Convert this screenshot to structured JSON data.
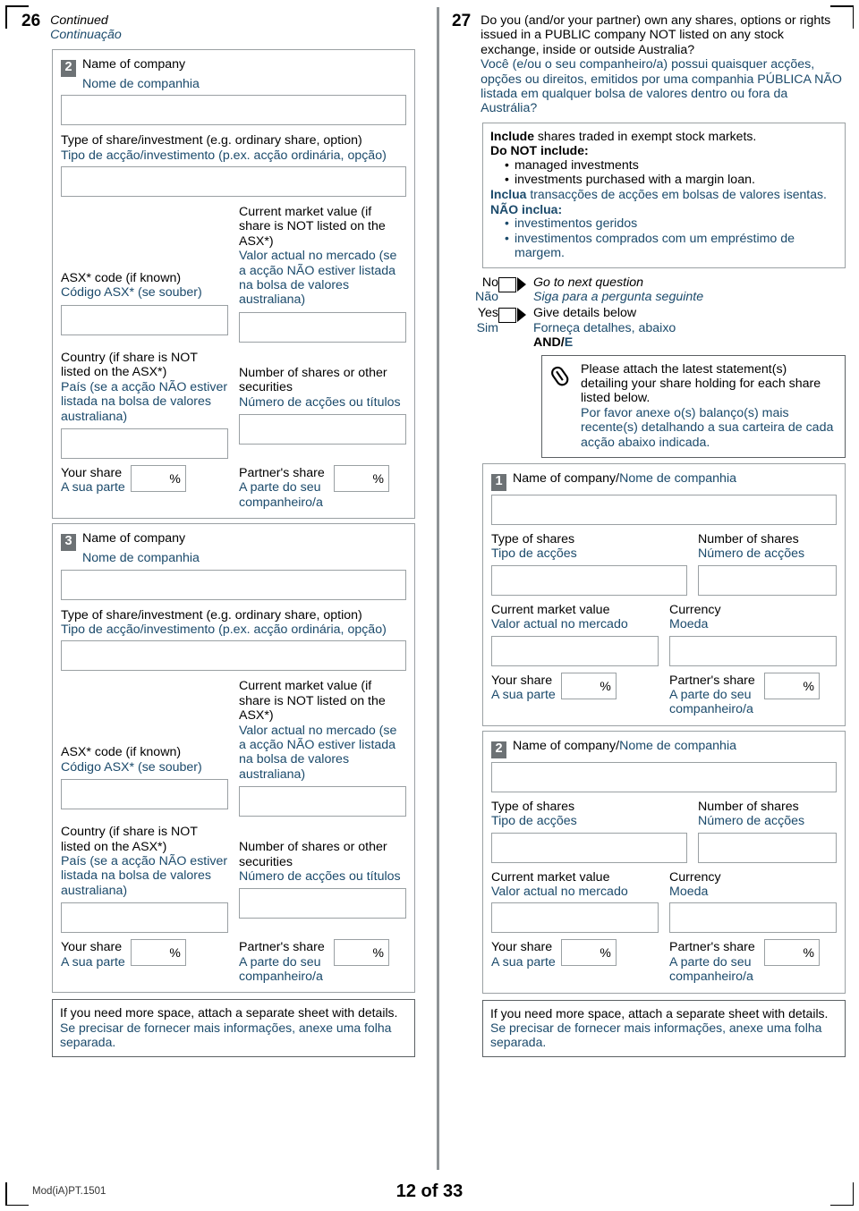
{
  "page": {
    "footer_code": "Mod(iA)PT.1501",
    "page_number": "12 of 33",
    "colors": {
      "accent_pt": "#1b4a6b",
      "badge_bg": "#6d7275",
      "box_border": "#9aa0a3"
    }
  },
  "question26": {
    "number": "26",
    "title_en": "Continued",
    "title_pt": "Continuação",
    "entries": [
      {
        "badge": "2",
        "name_of_company_en": "Name of company",
        "name_of_company_pt": "Nome de companhia",
        "type_of_share_en": "Type of share/investment (e.g. ordinary share, option)",
        "type_of_share_pt": "Tipo de acção/investimento (p.ex. acção ordinária, opção)",
        "asx_code_en": "ASX* code (if known)",
        "asx_code_pt": "Código ASX* (se souber)",
        "market_value_en": "Current market value (if share is NOT listed on the ASX*)",
        "market_value_pt": "Valor actual no mercado (se a acção NÃO estiver listada na bolsa de valores australiana)",
        "country_en": "Country (if share is NOT listed on the ASX*)",
        "country_pt": "País (se a acção NÃO estiver listada na bolsa de valores australiana)",
        "number_shares_en": "Number of shares or other securities",
        "number_shares_pt": "Número de acções ou títulos",
        "your_share_en": "Your share",
        "your_share_pt": "A sua parte",
        "partner_share_en": "Partner's share",
        "partner_share_pt": "A parte do seu companheiro/a",
        "percent_symbol": "%"
      },
      {
        "badge": "3",
        "name_of_company_en": "Name of company",
        "name_of_company_pt": "Nome de companhia",
        "type_of_share_en": "Type of share/investment (e.g. ordinary share, option)",
        "type_of_share_pt": "Tipo de acção/investimento (p.ex. acção ordinária, opção)",
        "asx_code_en": "ASX* code (if known)",
        "asx_code_pt": "Código ASX* (se souber)",
        "market_value_en": "Current market value (if share is NOT listed on the ASX*)",
        "market_value_pt": "Valor actual no mercado (se a acção NÃO estiver listada na bolsa de valores australiana)",
        "country_en": "Country (if share is NOT listed on the ASX*)",
        "country_pt": "País (se a acção NÃO estiver listada na bolsa de valores australiana)",
        "number_shares_en": "Number of shares or other securities",
        "number_shares_pt": "Número de acções ou títulos",
        "your_share_en": "Your share",
        "your_share_pt": "A sua parte",
        "partner_share_en": "Partner's share",
        "partner_share_pt": "A parte do seu companheiro/a",
        "percent_symbol": "%"
      }
    ],
    "more_space_en": "If you need more space, attach a separate sheet with details.",
    "more_space_pt": "Se precisar de fornecer mais informações, anexe uma folha separada."
  },
  "question27": {
    "number": "27",
    "question_en": "Do you (and/or your partner) own any shares, options or rights issued in a PUBLIC company NOT listed on any stock exchange, inside or outside Australia?",
    "question_pt": "Você (e/ou o seu companheiro/a) possui quaisquer acções, opções ou direitos, emitidos por uma companhia PÚBLICA NÃO listada em qualquer bolsa de valores dentro ou fora da Austrália?",
    "note": {
      "include_label_en": "Include",
      "include_text_en": " shares traded in exempt stock markets.",
      "donot_label_en": "Do NOT include:",
      "donot_items_en": [
        "managed investments",
        "investments purchased with a margin loan."
      ],
      "include_label_pt": "Inclua",
      "include_text_pt": " transacções de acções em bolsas de valores isentas.",
      "donot_label_pt": "NÃO inclua:",
      "donot_items_pt": [
        "investimentos geridos",
        "investimentos comprados com um empréstimo de margem."
      ]
    },
    "answers": {
      "no_en": "No",
      "no_pt": "Não",
      "no_action_en": "Go to next question",
      "no_action_pt": "Siga para a pergunta seguinte",
      "yes_en": "Yes",
      "yes_pt": "Sim",
      "yes_action_en": "Give details below",
      "yes_action_pt": "Forneça detalhes, abaixo",
      "and_en": "AND/",
      "and_pt": "E"
    },
    "attach": {
      "icon": "paperclip-icon",
      "text_en": "Please attach the latest statement(s) detailing your share holding for each share listed below.",
      "text_pt": "Por favor anexe o(s) balanço(s) mais recente(s) detalhando a sua carteira de cada acção abaixo indicada."
    },
    "entries": [
      {
        "badge": "1",
        "name_of_company": "Name of company/Nome de companhia",
        "type_of_shares_en": "Type of shares",
        "type_of_shares_pt": "Tipo de acções",
        "number_of_shares_en": "Number of shares",
        "number_of_shares_pt": "Número de acções",
        "market_value_en": "Current market value",
        "market_value_pt": "Valor actual no mercado",
        "currency_en": "Currency",
        "currency_pt": "Moeda",
        "your_share_en": "Your share",
        "your_share_pt": "A sua parte",
        "partner_share_en": "Partner's share",
        "partner_share_pt": "A parte do seu companheiro/a",
        "percent_symbol": "%"
      },
      {
        "badge": "2",
        "name_of_company": "Name of company/Nome de companhia",
        "type_of_shares_en": "Type of shares",
        "type_of_shares_pt": "Tipo de acções",
        "number_of_shares_en": "Number of shares",
        "number_of_shares_pt": "Número de acções",
        "market_value_en": "Current market value",
        "market_value_pt": "Valor actual no mercado",
        "currency_en": "Currency",
        "currency_pt": "Moeda",
        "your_share_en": "Your share",
        "your_share_pt": "A sua parte",
        "partner_share_en": "Partner's share",
        "partner_share_pt": "A parte do seu companheiro/a",
        "percent_symbol": "%"
      }
    ],
    "more_space_en": "If you need more space, attach a separate sheet with details.",
    "more_space_pt": "Se precisar de fornecer mais informações, anexe uma folha separada."
  }
}
